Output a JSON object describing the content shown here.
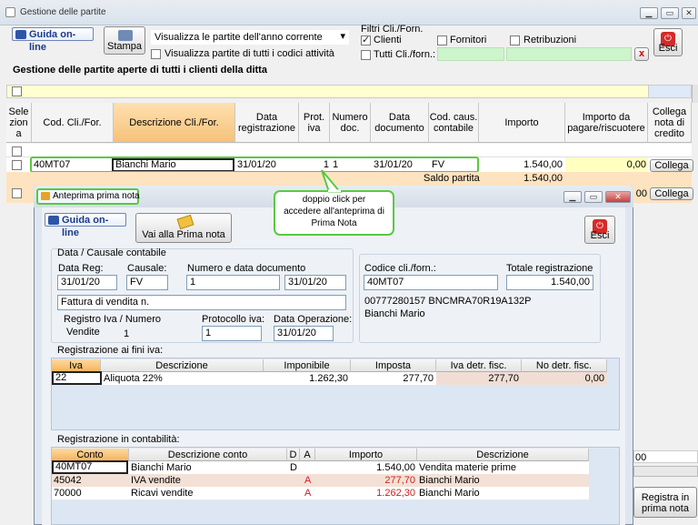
{
  "window": {
    "title": "Gestione delle partite",
    "min": "▁",
    "max": "▭",
    "close": "✕"
  },
  "toolbar": {
    "guida": "Guida on-line",
    "stampa": "Stampa",
    "year_select": "Visualizza le partite dell'anno corrente",
    "all_codes": "Visualizza partite di tutti i codici attività",
    "filters_label": "Filtri Cli./Forn.",
    "clienti": "Clienti",
    "fornitori": "Fornitori",
    "retribuzioni": "Retribuzioni",
    "tutti": "Tutti Cli./forn.:",
    "clear": "x",
    "esci": "Esci"
  },
  "heading": "Gestione delle partite aperte di tutti i clienti della ditta",
  "table": {
    "columns": [
      "Sele zion a",
      "Cod. Cli./For.",
      "Descrizione Cli./For.",
      "Data registrazione",
      "Prot. iva",
      "Numero doc.",
      "Data documento",
      "Cod. caus. contabile",
      "Importo",
      "Importo da pagare/riscuotere",
      "Collega nota di credito"
    ],
    "row": {
      "code": "40MT07",
      "desc": "Bianchi Mario",
      "date": "31/01/20",
      "prot": "1",
      "num": "1",
      "ddoc": "31/01/20",
      "caus": "FV",
      "importo": "1.540,00",
      "da_pagare": "0,00",
      "collega": "Collega"
    },
    "saldo_label": "Saldo partita",
    "saldo_value": "1.540,00",
    "collega2": "Collega"
  },
  "callout": "doppio click per accedere all'anteprima di Prima Nota",
  "preview": {
    "title": "Anteprima prima nota",
    "guida": "Guida on-line",
    "vai": "Vai alla Prima nota",
    "esci": "Esci",
    "section1": "Data / Causale contabile",
    "data_reg_label": "Data Reg:",
    "data_reg": "31/01/20",
    "causale_label": "Causale:",
    "causale": "FV",
    "num_label": "Numero e data documento",
    "num": "1",
    "num_date": "31/01/20",
    "descr": "Fattura di vendita n.",
    "registro_label": "Registro Iva / Numero",
    "registro": "Vendite",
    "registro_num": "1",
    "protocollo_label": "Protocollo iva:",
    "protocollo": "1",
    "data_op_label": "Data Operazione:",
    "data_op": "31/01/20",
    "codice_label": "Codice cli./forn.:",
    "codice": "40MT07",
    "totale_label": "Totale registrazione",
    "totale": "1.540,00",
    "cf": "00777280157 BNCMRA70R19A132P",
    "nome": "Bianchi Mario",
    "iva_section": "Registrazione ai fini iva:",
    "iva_cols": [
      "Iva",
      "Descrizione",
      "Imponibile",
      "Imposta",
      "Iva detr. fisc.",
      "No detr. fisc."
    ],
    "iva_row": [
      "22",
      "Aliquota 22%",
      "1.262,30",
      "277,70",
      "277,70",
      "0,00"
    ],
    "cont_section": "Registrazione in contabilità:",
    "cont_cols": [
      "Conto",
      "Descrizione conto",
      "D",
      "A",
      "Importo",
      "Descrizione"
    ],
    "cont_rows": [
      [
        "40MT07",
        "Bianchi Mario",
        "D",
        "",
        "1.540,00",
        "Vendita materie prime"
      ],
      [
        "45042",
        "IVA vendite",
        "",
        "A",
        "277,70",
        "Bianchi Mario"
      ],
      [
        "70000",
        "Ricavi vendite",
        "",
        "A",
        "1.262,30",
        "Bianchi Mario"
      ]
    ]
  },
  "bottom": {
    "registra": "Registra in prima nota",
    "partial_num": "00"
  }
}
